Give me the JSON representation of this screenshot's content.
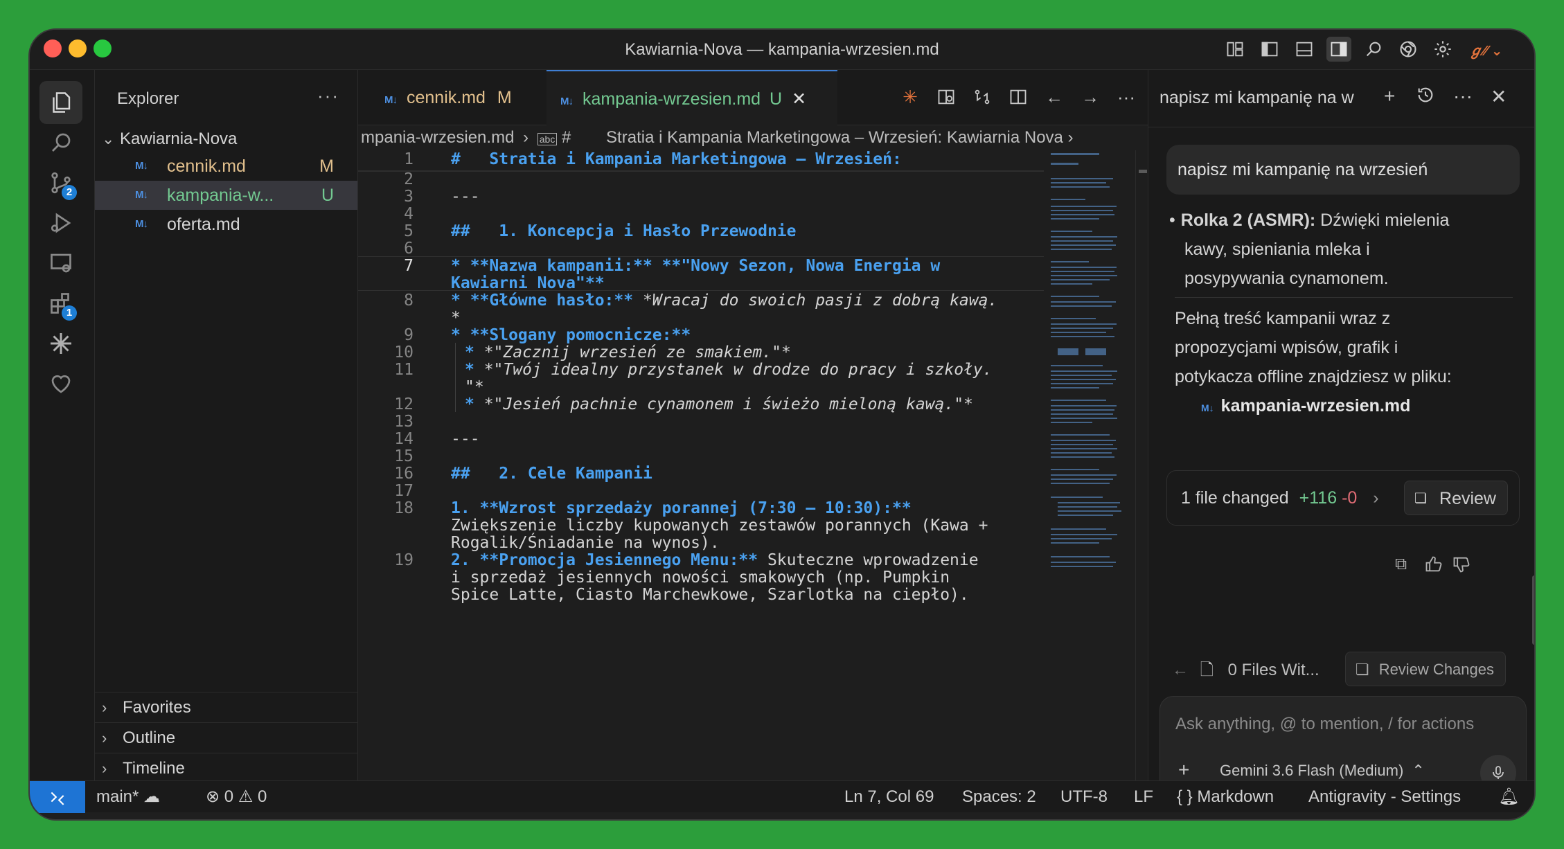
{
  "window": {
    "title": "Kawiarnia-Nova — kampania-wrzesien.md"
  },
  "sidebar": {
    "header": "Explorer",
    "more": "···",
    "folder": "Kawiarnia-Nova",
    "files": [
      {
        "icon": "M↓",
        "name": "cennik.md",
        "status": "M"
      },
      {
        "icon": "M↓",
        "name": "kampania-w...",
        "status": "U"
      },
      {
        "icon": "M↓",
        "name": "oferta.md",
        "status": ""
      }
    ],
    "sections": [
      "Favorites",
      "Outline",
      "Timeline"
    ]
  },
  "activity": {
    "scm_badge": "2",
    "ext_badge": "1"
  },
  "editor": {
    "tabs": [
      {
        "icon": "M↓",
        "label": "cennik.md",
        "status": "M"
      },
      {
        "icon": "M↓",
        "label": "kampania-wrzesien.md",
        "status": "U"
      }
    ],
    "breadcrumbs": {
      "file": "mpania-wrzesien.md",
      "hash": "#",
      "heading": "Stratia i Kampania Marketingowa – Wrzesień: Kawiarnia Nova"
    },
    "lines": {
      "l1": "#   Stratia i Kampania Marketingowa – Wrzesień:",
      "l3": "---",
      "l5": "##   1. Koncepcja i Hasło Przewodnie",
      "l7a": "* **Nazwa kampanii:** **\"Nowy Sezon, Nowa Energia w",
      "l7b": "Kawiarni Nova\"**",
      "l8a_k": "* **Główne hasło:**",
      "l8a_t": " *Wracaj do swoich pasji z dobrą kawą.",
      "l8b": "*",
      "l9": "* **Slogany pomocnicze:**",
      "l10_b": "* ",
      "l10_t": "*\"Zacznij wrzesień ze smakiem.\"*",
      "l11_b": "* ",
      "l11_t": "*\"Twój idealny przystanek w drodze do pracy i szkoły.",
      "l11c": "\"*",
      "l12_b": "* ",
      "l12_t": "*\"Jesień pachnie cynamonem i świeżo mieloną kawą.\"*",
      "l14": "---",
      "l16": "##   2. Cele Kampanii",
      "l18_k": "1. **Wzrost sprzedaży porannej (7:30 – 10:30):**",
      "l18b": "Zwiększenie liczby kupowanych zestawów porannych (Kawa +",
      "l18c": "Rogalik/Śniadanie na wynos).",
      "l19_k": "2. **Promocja Jesiennego Menu:**",
      "l19_t": " Skuteczne wprowadzenie",
      "l19b": "i sprzedaż jesiennych nowości smakowych (np. Pumpkin",
      "l19c": "Spice Latte, Ciasto Marchewkowe, Szarlotka na ciepło)."
    },
    "line_numbers": [
      "1",
      "2",
      "3",
      "4",
      "5",
      "6",
      "7",
      "8",
      "9",
      "10",
      "11",
      "12",
      "13",
      "14",
      "15",
      "16",
      "17",
      "18",
      "19"
    ]
  },
  "chat": {
    "title": "napisz mi kampanię na w",
    "user_message": "napisz mi kampanię na wrzesień",
    "bullet_bold": "Rolka 2 (ASMR):",
    "bullet_text_1": " Dźwięki mielenia",
    "bullet_text_2": "kawy, spieniania mleka i",
    "bullet_text_3": "posypywania cynamonem.",
    "para_1": "Pełną treść kampanii wraz z",
    "para_2": "propozycjami wpisów, grafik i",
    "para_3": "potykacza offline znajdziesz w pliku:",
    "file_ref": "kampania-wrzesien.md",
    "files_changed": "1 file changed",
    "added": "+116",
    "removed": "-0",
    "review": "Review",
    "files_with": "0 Files Wit...",
    "review_changes": "Review Changes",
    "input_placeholder": "Ask anything, @ to mention, / for actions",
    "model": "Gemini 3.6 Flash (Medium)"
  },
  "status": {
    "branch": "main*",
    "errors": "0",
    "warnings": "0",
    "position": "Ln 7, Col 69",
    "spaces": "Spaces: 2",
    "encoding": "UTF-8",
    "eol": "LF",
    "language": "Markdown",
    "settings": "Antigravity - Settings"
  },
  "colors": {
    "accent": "#1e74d4",
    "modified": "#e2c08d",
    "untracked": "#73c991",
    "heading": "#4aa1f0"
  }
}
